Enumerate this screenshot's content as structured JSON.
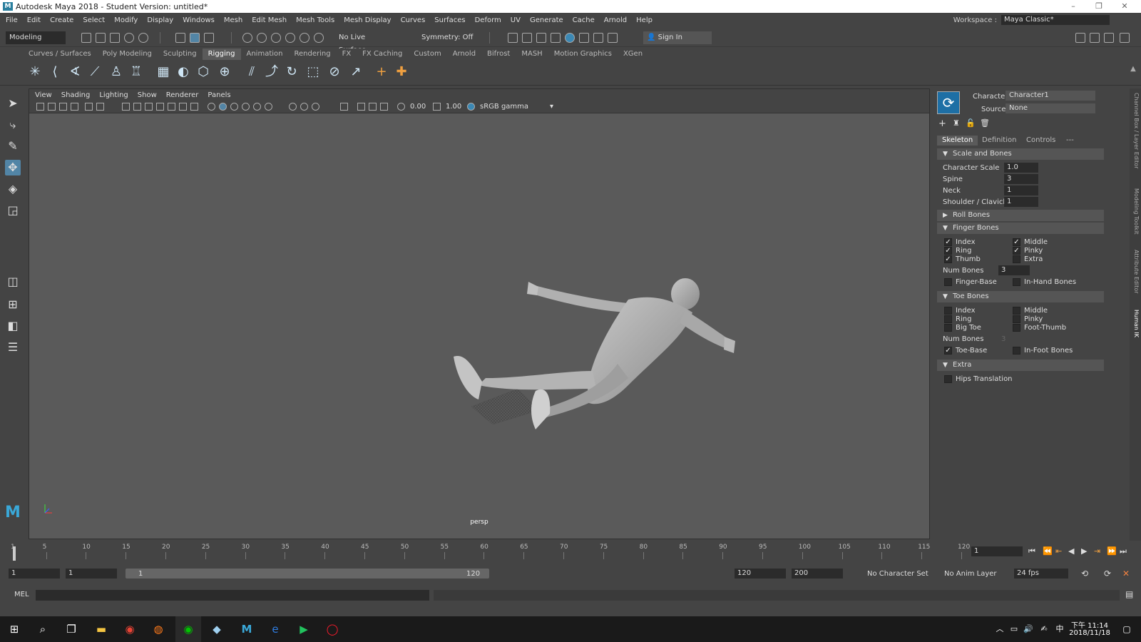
{
  "window": {
    "title": "Autodesk Maya 2018 - Student Version: untitled*",
    "logo": "M"
  },
  "menu": [
    "File",
    "Edit",
    "Create",
    "Select",
    "Modify",
    "Display",
    "Windows",
    "Mesh",
    "Edit Mesh",
    "Mesh Tools",
    "Mesh Display",
    "Curves",
    "Surfaces",
    "Deform",
    "UV",
    "Generate",
    "Cache",
    "Arnold",
    "Help"
  ],
  "workspace": {
    "label": "Workspace :",
    "value": "Maya Classic*"
  },
  "statusline": {
    "mode": "Modeling",
    "live_surface": "No Live Surface",
    "symmetry": "Symmetry: Off",
    "sign_in": "Sign In"
  },
  "shelf_tabs": [
    "Curves / Surfaces",
    "Poly Modeling",
    "Sculpting",
    "Rigging",
    "Animation",
    "Rendering",
    "FX",
    "FX Caching",
    "Custom",
    "Arnold",
    "Bifrost",
    "MASH",
    "Motion Graphics",
    "XGen"
  ],
  "active_shelf": "Rigging",
  "viewport": {
    "menu": [
      "View",
      "Shading",
      "Lighting",
      "Show",
      "Renderer",
      "Panels"
    ],
    "exposure": "0.00",
    "gamma": "1.00",
    "color_space": "sRGB gamma",
    "camera": "persp"
  },
  "hik": {
    "character_label": "Character:",
    "character_value": "Character1",
    "source_label": "Source:",
    "source_value": "None",
    "tabs": [
      "Skeleton",
      "Definition",
      "Controls",
      "---"
    ],
    "scale_and_bones": {
      "header": "Scale and Bones",
      "character_scale_label": "Character Scale",
      "character_scale": "1.0",
      "spine_label": "Spine",
      "spine": "3",
      "neck_label": "Neck",
      "neck": "1",
      "shoulder_label": "Shoulder / Clavicle",
      "shoulder": "1"
    },
    "roll_bones": {
      "header": "Roll Bones"
    },
    "finger_bones": {
      "header": "Finger Bones",
      "index": "Index",
      "middle": "Middle",
      "ring": "Ring",
      "pinky": "Pinky",
      "thumb": "Thumb",
      "extra": "Extra",
      "num_bones_label": "Num Bones",
      "num_bones": "3",
      "finger_base": "Finger-Base",
      "in_hand": "In-Hand Bones"
    },
    "toe_bones": {
      "header": "Toe Bones",
      "index": "Index",
      "middle": "Middle",
      "ring": "Ring",
      "pinky": "Pinky",
      "big_toe": "Big Toe",
      "foot_thumb": "Foot-Thumb",
      "num_bones_label": "Num Bones",
      "num_bones": "3",
      "toe_base": "Toe-Base",
      "in_foot": "In-Foot Bones"
    },
    "extra": {
      "header": "Extra",
      "hips": "Hips Translation"
    }
  },
  "side_tabs": [
    "Channel Box / Layer Editor",
    "Modeling Toolkit",
    "Attribute Editor",
    "Human IK"
  ],
  "timeline": {
    "ticks": [
      "1",
      "5",
      "10",
      "15",
      "20",
      "25",
      "30",
      "35",
      "40",
      "45",
      "50",
      "55",
      "60",
      "65",
      "70",
      "75",
      "80",
      "85",
      "90",
      "95",
      "100",
      "105",
      "110",
      "115",
      "120"
    ],
    "current_frame": "1"
  },
  "range": {
    "start": "1",
    "anim_start": "1",
    "slider_start": "1",
    "slider_end": "120",
    "anim_end": "120",
    "end": "200",
    "char_set": "No Character Set",
    "anim_layer": "No Anim Layer",
    "fps": "24 fps"
  },
  "cmdline": {
    "lang": "MEL"
  },
  "taskbar": {
    "time": "下午 11:14",
    "date": "2018/11/18",
    "ime": "中"
  },
  "colors": {
    "accent": "#5285a6",
    "panel": "#444444",
    "viewport": "#5a5a5a"
  }
}
